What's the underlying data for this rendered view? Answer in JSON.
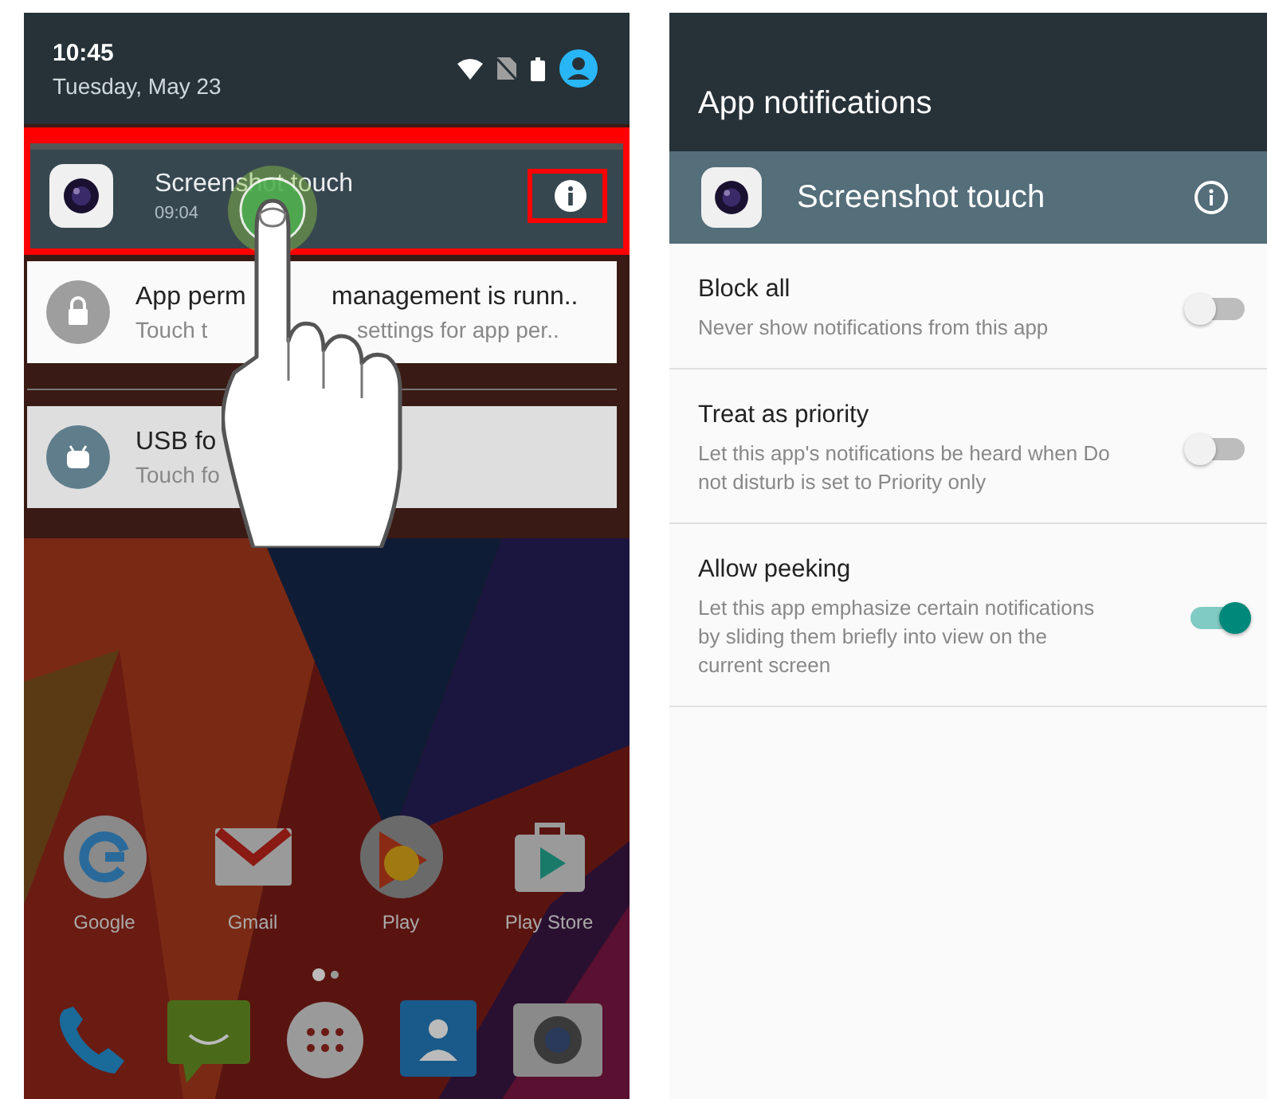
{
  "status": {
    "time": "10:45",
    "date": "Tuesday, May 23"
  },
  "notifications": [
    {
      "kind": "highlighted",
      "title_parts": [
        "Screenshot touch"
      ],
      "text_parts": [
        "09:04"
      ]
    },
    {
      "kind": "card",
      "title_parts": [
        "App perm",
        "management is runn.."
      ],
      "text_parts": [
        "Touch t",
        "settings for app per.."
      ]
    },
    {
      "kind": "card",
      "title_parts": [
        "USB fo"
      ],
      "text_parts": [
        "Touch fo"
      ]
    }
  ],
  "apps": [
    {
      "label": "Google"
    },
    {
      "label": "Gmail"
    },
    {
      "label": "Play"
    },
    {
      "label": "Play Store"
    }
  ],
  "settings": {
    "title": "App notifications",
    "app_name": "Screenshot touch",
    "items": [
      {
        "label": "Block all",
        "description": "Never show notifications from this app",
        "on": false
      },
      {
        "label": "Treat as priority",
        "description": "Let this app's notifications be heard when Do not disturb is set to Priority only",
        "on": false
      },
      {
        "label": "Allow peeking",
        "description": "Let this app emphasize certain notifications by sliding them briefly into view on the current screen",
        "on": true
      }
    ]
  }
}
